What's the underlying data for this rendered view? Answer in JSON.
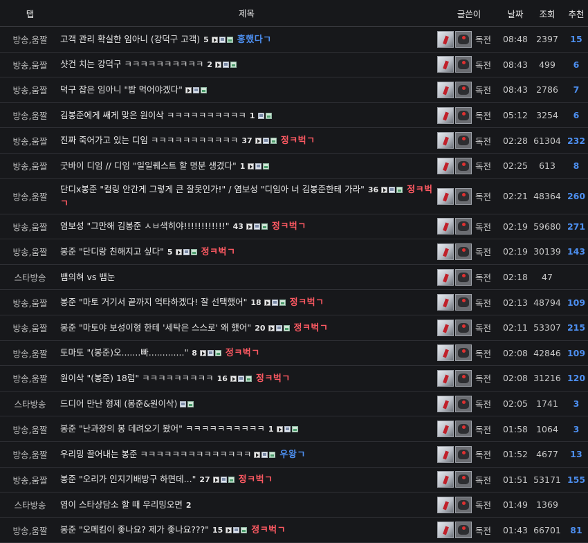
{
  "header": {
    "tab": "탭",
    "title": "제목",
    "writer": "글쓴이",
    "date": "날짜",
    "views": "조회",
    "recommend": "추천"
  },
  "rows": [
    {
      "tab": "방송,움짤",
      "title": "고객 관리 확실한 임아니 (강덕구 고객)",
      "comments": "5",
      "icons": [
        "play",
        "file",
        "img"
      ],
      "badge": "홍했다ㄱ",
      "badge_color": "blue",
      "writer": "독전",
      "date": "08:48",
      "views": "2397",
      "rec": "15"
    },
    {
      "tab": "방송,움짤",
      "title": "샷건 치는 강덕구 ㅋㅋㅋㅋㅋㅋㅋㅋㅋㅋ",
      "comments": "2",
      "icons": [
        "play",
        "file",
        "img"
      ],
      "badge": "",
      "badge_color": "",
      "writer": "독전",
      "date": "08:43",
      "views": "499",
      "rec": "6"
    },
    {
      "tab": "방송,움짤",
      "title": "덕구 잡은 임아니 \"밥 먹어야겠다\"",
      "comments": "",
      "icons": [
        "play",
        "file",
        "img"
      ],
      "badge": "",
      "badge_color": "",
      "writer": "독전",
      "date": "08:43",
      "views": "2786",
      "rec": "7"
    },
    {
      "tab": "방송,움짤",
      "title": "김봉준에게 쌔게 맞은 원이삭 ㅋㅋㅋㅋㅋㅋㅋㅋㅋㅋ",
      "comments": "1",
      "icons": [
        "file",
        "img"
      ],
      "badge": "",
      "badge_color": "",
      "writer": "독전",
      "date": "05:12",
      "views": "3254",
      "rec": "6"
    },
    {
      "tab": "방송,움짤",
      "title": "진짜 죽어가고 있는 디임 ㅋㅋㅋㅋㅋㅋㅋㅋㅋㅋㅋ",
      "comments": "37",
      "icons": [
        "play",
        "file",
        "img"
      ],
      "badge": "정ㅋ벅ㄱ",
      "badge_color": "red",
      "writer": "독전",
      "date": "02:28",
      "views": "61304",
      "rec": "232"
    },
    {
      "tab": "방송,움짤",
      "title": "굿바이 디임 // 디임 \"일일퀘스트 할 명분 생겼다\"",
      "comments": "1",
      "icons": [
        "play",
        "file",
        "img"
      ],
      "badge": "",
      "badge_color": "",
      "writer": "독전",
      "date": "02:25",
      "views": "613",
      "rec": "8"
    },
    {
      "tab": "방송,움짤",
      "title": "단디x봉준 \"컬링 안간게 그렇게 큰 잘못인가!\" / 염보성 \"디임아 너 김봉준한테 가라\"",
      "comments": "36",
      "icons": [
        "play",
        "file",
        "img"
      ],
      "badge": "정ㅋ벅ㄱ",
      "badge_color": "red",
      "writer": "독전",
      "date": "02:21",
      "views": "48364",
      "rec": "260",
      "tall": true
    },
    {
      "tab": "방송,움짤",
      "title": "염보성 \"그만해 김봉준 ㅅㅂ색히야!!!!!!!!!!!!\"",
      "comments": "43",
      "icons": [
        "play",
        "file",
        "img"
      ],
      "badge": "정ㅋ벅ㄱ",
      "badge_color": "red",
      "writer": "독전",
      "date": "02:19",
      "views": "59680",
      "rec": "271"
    },
    {
      "tab": "방송,움짤",
      "title": "봉준 \"단디랑 친해지고 싶다\"",
      "comments": "5",
      "icons": [
        "play",
        "file",
        "img"
      ],
      "badge": "정ㅋ벅ㄱ",
      "badge_color": "red",
      "writer": "독전",
      "date": "02:19",
      "views": "30139",
      "rec": "143"
    },
    {
      "tab": "스타방송",
      "title": "뱀의혀 vs 뱀눈",
      "comments": "",
      "icons": [],
      "badge": "",
      "badge_color": "",
      "writer": "독전",
      "date": "02:18",
      "views": "47",
      "rec": ""
    },
    {
      "tab": "방송,움짤",
      "title": "봉준 \"마토 거기서 끝까지 억타하겠다! 잘 선택했어\"",
      "comments": "18",
      "icons": [
        "play",
        "file",
        "img"
      ],
      "badge": "정ㅋ벅ㄱ",
      "badge_color": "red",
      "writer": "독전",
      "date": "02:13",
      "views": "48794",
      "rec": "109"
    },
    {
      "tab": "방송,움짤",
      "title": "봉준 \"마토야 보성이형 한테 '세탁은 스스로' 왜 했어\"",
      "comments": "20",
      "icons": [
        "play",
        "file",
        "img"
      ],
      "badge": "정ㅋ벅ㄱ",
      "badge_color": "red",
      "writer": "독전",
      "date": "02:11",
      "views": "53307",
      "rec": "215"
    },
    {
      "tab": "방송,움짤",
      "title": "토마토 \"(봉준)오.......빠.............\"",
      "comments": "8",
      "icons": [
        "play",
        "file",
        "img"
      ],
      "badge": "정ㅋ벅ㄱ",
      "badge_color": "red",
      "writer": "독전",
      "date": "02:08",
      "views": "42846",
      "rec": "109"
    },
    {
      "tab": "방송,움짤",
      "title": "원이삭 \"(봉준) 18럼\" ㅋㅋㅋㅋㅋㅋㅋㅋㅋ",
      "comments": "16",
      "icons": [
        "play",
        "file",
        "img"
      ],
      "badge": "정ㅋ벅ㄱ",
      "badge_color": "red",
      "writer": "독전",
      "date": "02:08",
      "views": "31216",
      "rec": "120"
    },
    {
      "tab": "스타방송",
      "title": "드디어 만난 형제 (봉준&원이삭)",
      "comments": "",
      "icons": [
        "file",
        "img"
      ],
      "badge": "",
      "badge_color": "",
      "writer": "독전",
      "date": "02:05",
      "views": "1741",
      "rec": "3"
    },
    {
      "tab": "방송,움짤",
      "title": "봉준 \"난과장의 봉 데려오기 봤어\" ㅋㅋㅋㅋㅋㅋㅋㅋㅋㅋ",
      "comments": "1",
      "icons": [
        "play",
        "file",
        "img"
      ],
      "badge": "",
      "badge_color": "",
      "writer": "독전",
      "date": "01:58",
      "views": "1064",
      "rec": "3"
    },
    {
      "tab": "방송,움짤",
      "title": "우리밍 끌어내는 봉준 ㅋㅋㅋㅋㅋㅋㅋㅋㅋㅋㅋㅋㅋㅋ",
      "comments": "",
      "icons": [
        "play",
        "file",
        "img"
      ],
      "badge": "우왕ㄱ",
      "badge_color": "blue",
      "writer": "독전",
      "date": "01:52",
      "views": "4677",
      "rec": "13"
    },
    {
      "tab": "방송,움짤",
      "title": "봉준 \"오리가 인지기배방구 하면데...\"",
      "comments": "27",
      "icons": [
        "play",
        "file",
        "img"
      ],
      "badge": "정ㅋ벅ㄱ",
      "badge_color": "red",
      "writer": "독전",
      "date": "01:51",
      "views": "53171",
      "rec": "155"
    },
    {
      "tab": "스타방송",
      "title": "염이 스타상담소 할 때 우리밍오면",
      "comments": "2",
      "icons": [],
      "badge": "",
      "badge_color": "",
      "writer": "독전",
      "date": "01:49",
      "views": "1369",
      "rec": ""
    },
    {
      "tab": "방송,움짤",
      "title": "봉준 \"오메킴이 좋나요? 제가 좋나요???\"",
      "comments": "15",
      "icons": [
        "play",
        "file",
        "img"
      ],
      "badge": "정ㅋ벅ㄱ",
      "badge_color": "red",
      "writer": "독전",
      "date": "01:43",
      "views": "66701",
      "rec": "81"
    }
  ],
  "colors": {
    "background": "#17181b",
    "recommend": "#4d8ff0",
    "badge_red": "#ff5a63",
    "badge_blue": "#4d8ff0"
  }
}
